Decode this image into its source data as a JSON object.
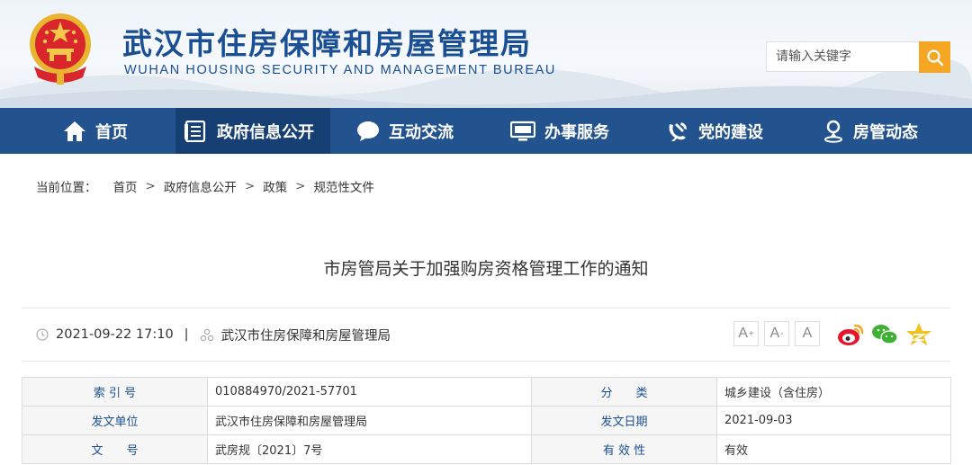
{
  "header": {
    "site_title": "武汉市住房保障和房屋管理局",
    "site_subtitle": "WUHAN HOUSING SECURITY AND MANAGEMENT BUREAU",
    "search_placeholder": "请输入关键字"
  },
  "nav": {
    "items": [
      {
        "label": "首页",
        "icon": "home-icon"
      },
      {
        "label": "政府信息公开",
        "icon": "document-icon",
        "active": true
      },
      {
        "label": "互动交流",
        "icon": "chat-bubble-icon"
      },
      {
        "label": "办事服务",
        "icon": "monitor-icon"
      },
      {
        "label": "党的建设",
        "icon": "party-emblem-icon"
      },
      {
        "label": "房管动态",
        "icon": "person-pin-icon"
      }
    ]
  },
  "breadcrumb": {
    "prefix": "当前位置：",
    "items": [
      "首页",
      "政府信息公开",
      "政策",
      "规范性文件"
    ]
  },
  "article": {
    "title": "市房管局关于加强购房资格管理工作的通知",
    "datetime": "2021-09-22 17:10",
    "source": "武汉市住房保障和房屋管理局"
  },
  "font_size": {
    "large": "A",
    "medium": "A",
    "small": "A"
  },
  "share": [
    "weibo-icon",
    "wechat-icon",
    "qzone-icon"
  ],
  "info_table": {
    "rows": [
      [
        {
          "key": "索 引 号",
          "value": "010884970/2021-57701"
        },
        {
          "key": "分　　类",
          "value": "城乡建设（含住房）"
        }
      ],
      [
        {
          "key": "发文单位",
          "value": "武汉市住房保障和房屋管理局"
        },
        {
          "key": "发文日期",
          "value": "2021-09-03"
        }
      ],
      [
        {
          "key": "文　　号",
          "value": "武房规〔2021〕7号"
        },
        {
          "key": "有 效 性",
          "value": "有效"
        }
      ]
    ]
  },
  "colors": {
    "brand": "#1a4f94",
    "nav": "#23538f",
    "nav_active": "#163f73",
    "accent": "#f5a623"
  }
}
